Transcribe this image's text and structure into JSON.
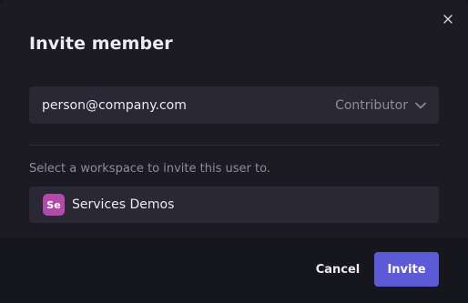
{
  "dialog": {
    "title": "Invite member",
    "close_icon": "close-icon"
  },
  "invite_form": {
    "email_value": "person@company.com",
    "role": {
      "selected": "Contributor",
      "icon": "chevron-down-icon"
    },
    "workspace_hint": "Select a workspace to invite this user to.",
    "workspace": {
      "initials": "Se",
      "name": "Services Demos",
      "avatar_color": "#b14aa8"
    }
  },
  "actions": {
    "cancel_label": "Cancel",
    "invite_label": "Invite",
    "accent_color": "#5c5ad6"
  }
}
